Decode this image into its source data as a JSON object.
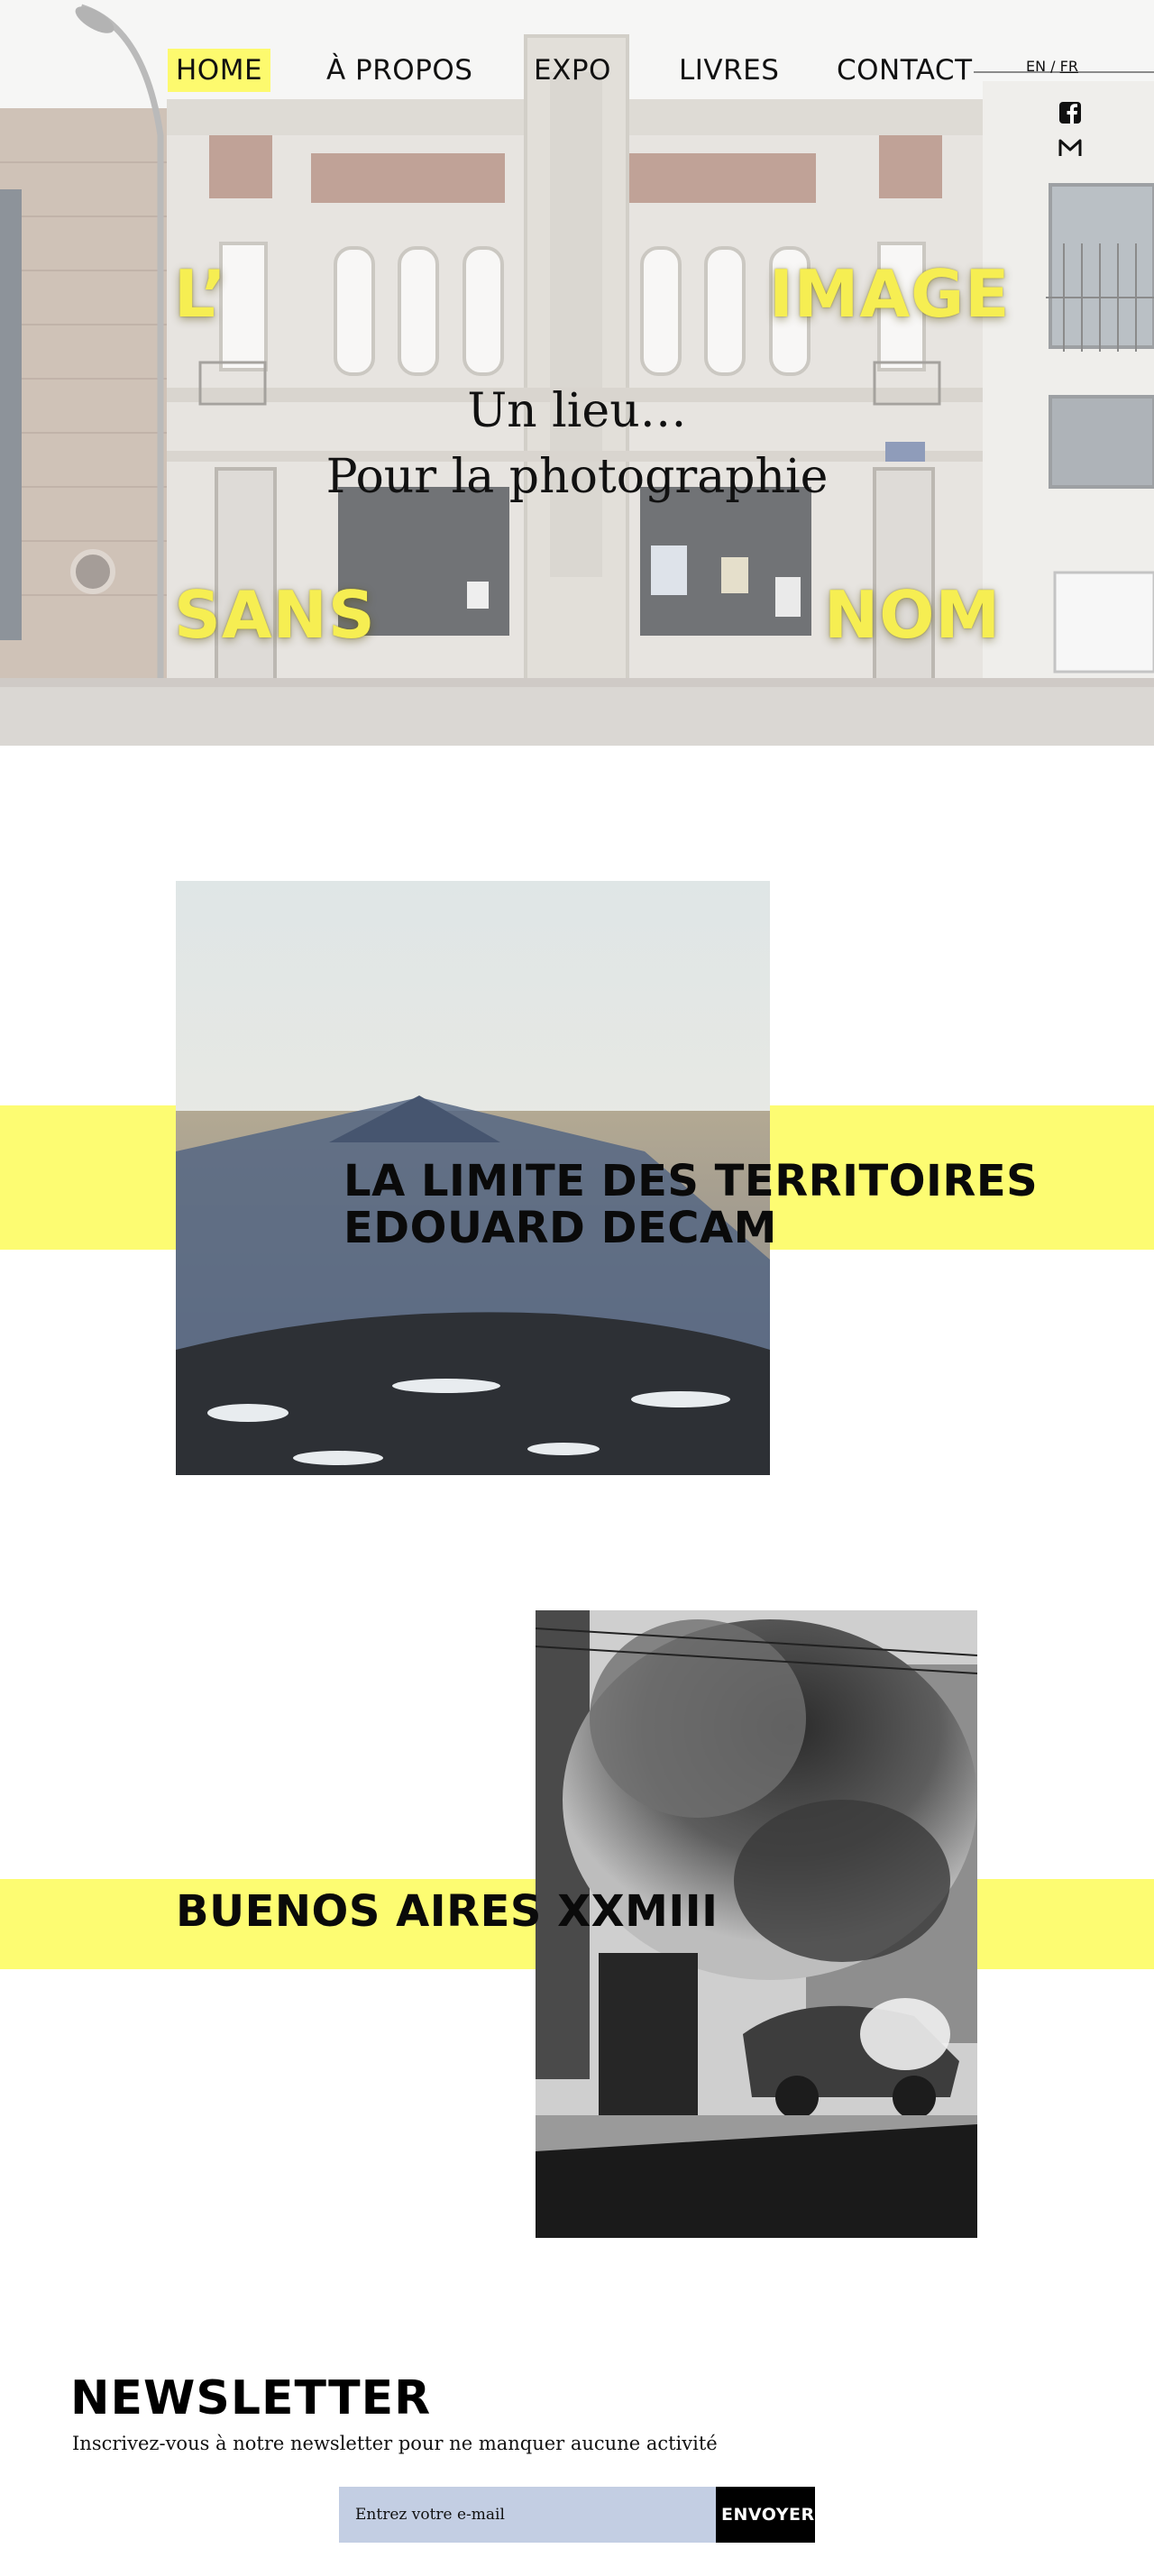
{
  "nav": {
    "items": [
      {
        "label": "HOME",
        "active": true
      },
      {
        "label": "À PROPOS"
      },
      {
        "label": "EXPO"
      },
      {
        "label": "LIVRES"
      },
      {
        "label": "CONTACT"
      }
    ],
    "lang_en": "EN",
    "lang_sep": "/",
    "lang_fr": "FR",
    "social_icons": [
      "facebook-icon",
      "mail-icon"
    ]
  },
  "hero": {
    "word_tl": "L’",
    "word_tr": "IMAGE",
    "word_bl": "SANS",
    "word_br": "NOM",
    "line1": "Un lieu…",
    "line2": "Pour la photographie",
    "accent_color": "#fdfa6e"
  },
  "exhibitions": [
    {
      "title_line1": "LA LIMITE DES TERRITOIRES",
      "title_line2": "EDOUARD DECAM"
    },
    {
      "title_line1": "BUENOS AIRES XXMIII"
    }
  ],
  "newsletter": {
    "title": "NEWSLETTER",
    "subtitle": "Inscrivez-vous à notre newsletter pour ne manquer aucune activité",
    "placeholder": "Entrez votre e-mail",
    "button": "ENVOYER"
  }
}
